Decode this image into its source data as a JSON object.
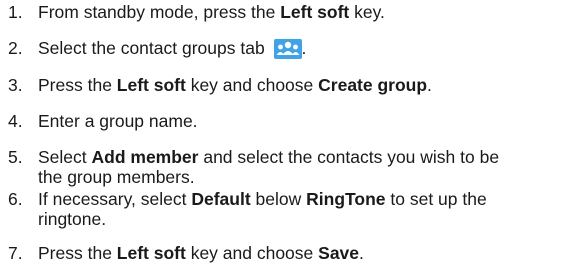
{
  "steps": [
    {
      "number": "1.",
      "pre": "From standby mode, press the ",
      "bold1": "Left soft",
      "post": " key."
    },
    {
      "number": "2.",
      "pre": "Select the contact groups tab ",
      "icon": "contact-groups-icon",
      "post": "."
    },
    {
      "number": "3.",
      "pre": "Press the ",
      "bold1": "Left soft",
      "mid": " key and choose ",
      "bold2": "Create group",
      "post": "."
    },
    {
      "number": "4.",
      "pre": "Enter a group name."
    },
    {
      "number": "5.",
      "pre": "Select ",
      "bold1": "Add member",
      "mid": " and select the contacts you wish to be",
      "line2": "the group members."
    },
    {
      "number": "6.",
      "pre": "If necessary, select ",
      "bold1": "Default",
      "mid": " below ",
      "bold2": "RingTone",
      "post": " to set up the",
      "line2": "ringtone."
    },
    {
      "number": "7.",
      "pre": "Press the ",
      "bold1": "Left soft",
      "mid": " key and choose ",
      "bold2": "Save",
      "post": "."
    }
  ],
  "colors": {
    "text": "#1a1a1a",
    "icon_bg": "#3fa3e6"
  }
}
